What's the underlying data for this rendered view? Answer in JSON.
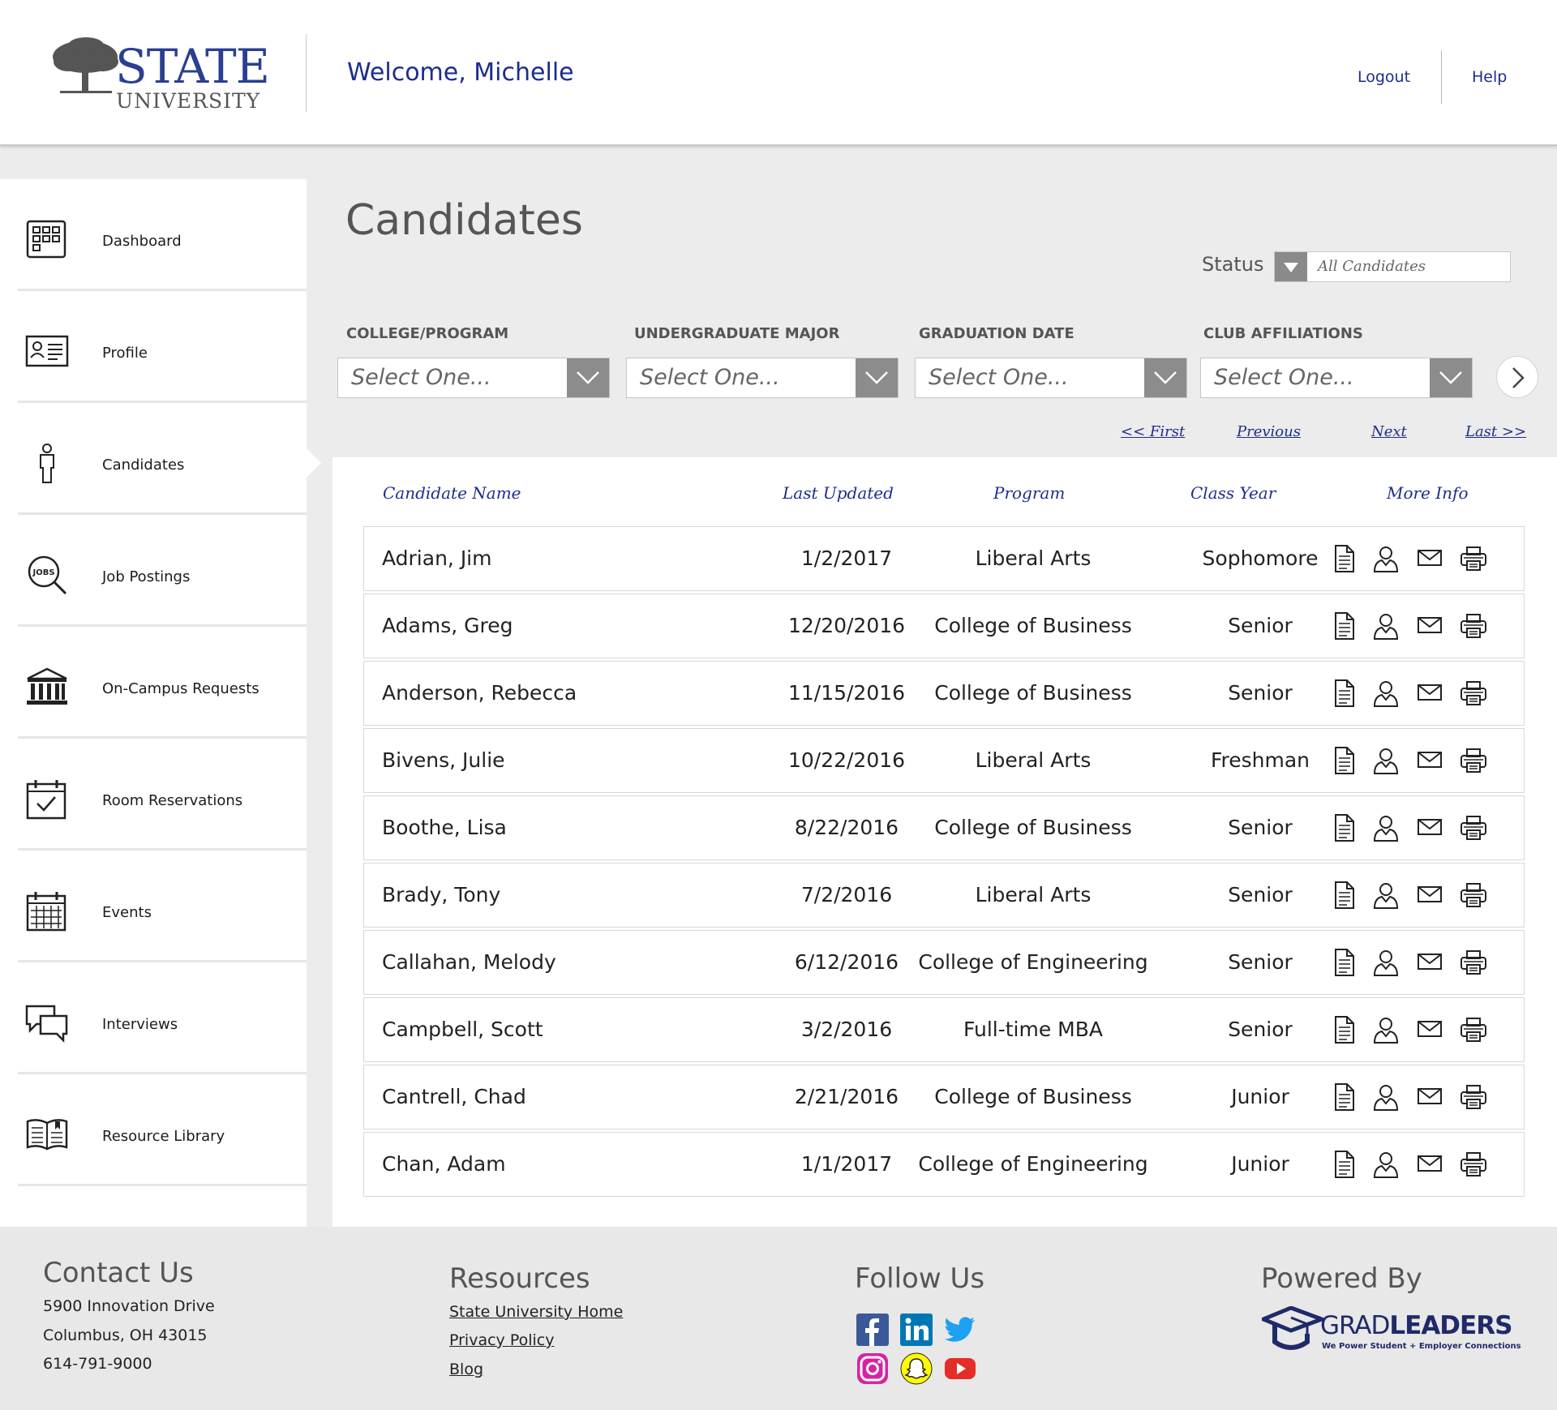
{
  "header": {
    "logo_word1": "STATE",
    "logo_word2": "UNIVERSITY",
    "welcome": "Welcome, Michelle",
    "logout": "Logout",
    "help": "Help"
  },
  "sidebar": {
    "items": [
      {
        "label": "Dashboard",
        "icon": "dashboard-grid-icon"
      },
      {
        "label": "Profile",
        "icon": "id-card-icon"
      },
      {
        "label": "Candidates",
        "icon": "person-icon",
        "active": true
      },
      {
        "label": "Job Postings",
        "icon": "jobs-search-icon"
      },
      {
        "label": "On-Campus Requests",
        "icon": "building-icon"
      },
      {
        "label": "Room Reservations",
        "icon": "calendar-check-icon"
      },
      {
        "label": "Events",
        "icon": "calendar-grid-icon"
      },
      {
        "label": "Interviews",
        "icon": "chat-bubbles-icon"
      },
      {
        "label": "Resource Library",
        "icon": "open-book-icon"
      }
    ]
  },
  "main": {
    "title": "Candidates",
    "status_label": "Status",
    "status_value": "All Candidates",
    "filters": [
      {
        "label": "COLLEGE/PROGRAM",
        "value": "Select One..."
      },
      {
        "label": "UNDERGRADUATE MAJOR",
        "value": "Select One..."
      },
      {
        "label": "GRADUATION DATE",
        "value": "Select One..."
      },
      {
        "label": "CLUB AFFILIATIONS",
        "value": "Select One..."
      }
    ],
    "pager": {
      "first": "<< First",
      "previous": "Previous",
      "next": "Next",
      "last": "Last >>"
    },
    "columns": [
      "Candidate Name",
      "Last Updated",
      "Program",
      "Class Year",
      "More Info"
    ],
    "rows": [
      {
        "name": "Adrian, Jim",
        "updated": "1/2/2017",
        "program": "Liberal Arts",
        "year": "Sophomore"
      },
      {
        "name": "Adams, Greg",
        "updated": "12/20/2016",
        "program": "College of Business",
        "year": "Senior"
      },
      {
        "name": "Anderson, Rebecca",
        "updated": "11/15/2016",
        "program": "College of Business",
        "year": "Senior"
      },
      {
        "name": "Bivens, Julie",
        "updated": "10/22/2016",
        "program": "Liberal Arts",
        "year": "Freshman"
      },
      {
        "name": "Boothe, Lisa",
        "updated": "8/22/2016",
        "program": "College of Business",
        "year": "Senior"
      },
      {
        "name": "Brady, Tony",
        "updated": "7/2/2016",
        "program": "Liberal Arts",
        "year": "Senior"
      },
      {
        "name": "Callahan, Melody",
        "updated": "6/12/2016",
        "program": "College of Engineering",
        "year": "Senior"
      },
      {
        "name": "Campbell, Scott",
        "updated": "3/2/2016",
        "program": "Full-time MBA",
        "year": "Senior"
      },
      {
        "name": "Cantrell, Chad",
        "updated": "2/21/2016",
        "program": "College of Business",
        "year": "Junior"
      },
      {
        "name": "Chan, Adam",
        "updated": "1/1/2017",
        "program": "College of Engineering",
        "year": "Junior"
      }
    ],
    "row_actions": [
      "document-icon",
      "profile-icon",
      "mail-icon",
      "print-icon"
    ]
  },
  "footer": {
    "contact_heading": "Contact Us",
    "address1": "5900 Innovation Drive",
    "address2": "Columbus, OH 43015",
    "phone": "614-791-9000",
    "resources_heading": "Resources",
    "resources_links": [
      "State University Home",
      "Privacy Policy",
      "Blog"
    ],
    "follow_heading": "Follow Us",
    "social": [
      "facebook-icon",
      "linkedin-icon",
      "twitter-icon",
      "instagram-icon",
      "snapchat-icon",
      "youtube-icon"
    ],
    "powered_heading": "Powered By",
    "powered_brand_a": "GRAD",
    "powered_brand_b": "LEADERS",
    "powered_tagline": "We Power Student + Employer Connections"
  },
  "colors": {
    "accent_blue": "#1d2d8c",
    "logo_blue": "#2a3f91",
    "background": "#ececec",
    "select_button": "#8c8c8c"
  }
}
